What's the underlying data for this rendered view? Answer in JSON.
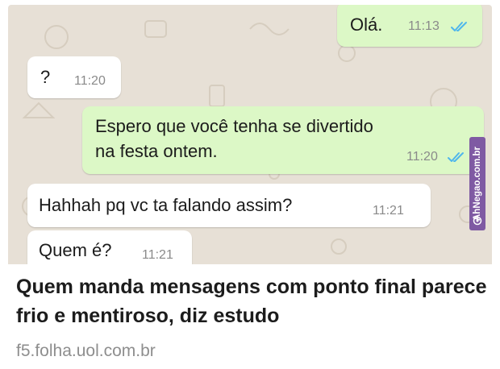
{
  "messages": [
    {
      "direction": "outgoing",
      "text": "Olá.",
      "time": "11:13",
      "ticks": "double-check-icon"
    },
    {
      "direction": "incoming",
      "text": "?",
      "time": "11:20"
    },
    {
      "direction": "outgoing",
      "text_line1": "Espero que você tenha se divertido",
      "text_line2": "na festa ontem.",
      "time": "11:20",
      "ticks": "double-check-icon"
    },
    {
      "direction": "incoming",
      "text": "Hahhah pq vc ta falando assim?",
      "time": "11:21"
    },
    {
      "direction": "incoming",
      "text": "Quem é?",
      "time": "11:21"
    }
  ],
  "watermark": {
    "text": "AhNegao.com.br",
    "icon": "spiral-logo-icon"
  },
  "link_preview": {
    "headline": "Quem manda mensagens com ponto final parece frio e mentiroso, diz estudo",
    "domain": "f5.folha.uol.com.br"
  },
  "colors": {
    "chat_background": "#e7e0d6",
    "outgoing_bubble": "#dcf8c6",
    "incoming_bubble": "#ffffff",
    "read_ticks": "#4fb6ec",
    "watermark": "#7f5aa3"
  }
}
